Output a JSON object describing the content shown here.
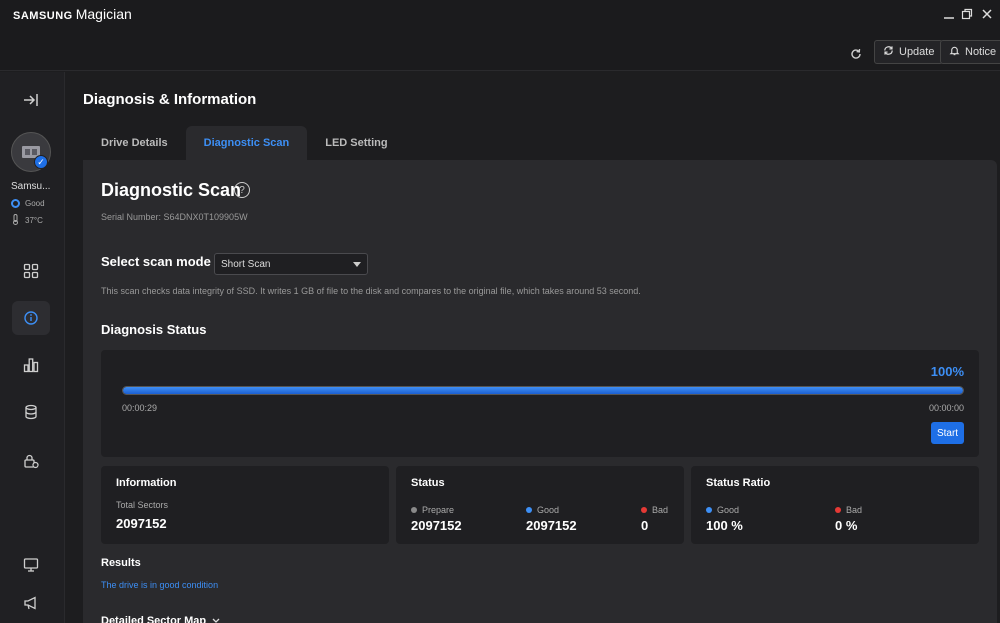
{
  "app": {
    "brand": "SAMSUNG",
    "product": "Magician"
  },
  "topbar": {
    "update_label": "Update",
    "notice_label": "Notice"
  },
  "sidebar": {
    "drive_name": "Samsu...",
    "drive_health": "Good",
    "drive_temp": "37°C"
  },
  "page": {
    "title": "Diagnosis & Information",
    "tabs": [
      {
        "label": "Drive Details"
      },
      {
        "label": "Diagnostic Scan"
      },
      {
        "label": "LED Setting"
      }
    ],
    "active_tab": "Diagnostic Scan"
  },
  "scan": {
    "heading": "Diagnostic Scan",
    "help_glyph": "?",
    "serial": "Serial Number: S64DNX0T109905W",
    "mode_label": "Select scan mode",
    "mode_value": "Short Scan",
    "description": "This scan checks data integrity of SSD. It writes 1 GB of file to the disk and compares to the original file, which takes around 53 second."
  },
  "status": {
    "heading": "Diagnosis Status",
    "percent_text": "100%",
    "progress_fraction": 1.0,
    "elapsed": "00:00:29",
    "remaining": "00:00:00",
    "start_label": "Start"
  },
  "cards": {
    "information": {
      "title": "Information",
      "label": "Total Sectors",
      "value": "2097152"
    },
    "status": {
      "title": "Status",
      "items": [
        {
          "label": "Prepare",
          "value": "2097152",
          "color": "#8a8a8a"
        },
        {
          "label": "Good",
          "value": "2097152",
          "color": "#3d8ff5"
        },
        {
          "label": "Bad",
          "value": "0",
          "color": "#e53935"
        }
      ]
    },
    "ratio": {
      "title": "Status Ratio",
      "items": [
        {
          "label": "Good",
          "value": "100 %",
          "color": "#3d8ff5"
        },
        {
          "label": "Bad",
          "value": "0 %",
          "color": "#e53935"
        }
      ]
    }
  },
  "results": {
    "heading": "Results",
    "text": "The drive is in good condition"
  },
  "detail": {
    "heading": "Detailed Sector Map"
  },
  "colors": {
    "accent": "#1e6fe6",
    "accent_text": "#3d8ff5",
    "bad": "#e53935",
    "neutral": "#8a8a8a"
  }
}
